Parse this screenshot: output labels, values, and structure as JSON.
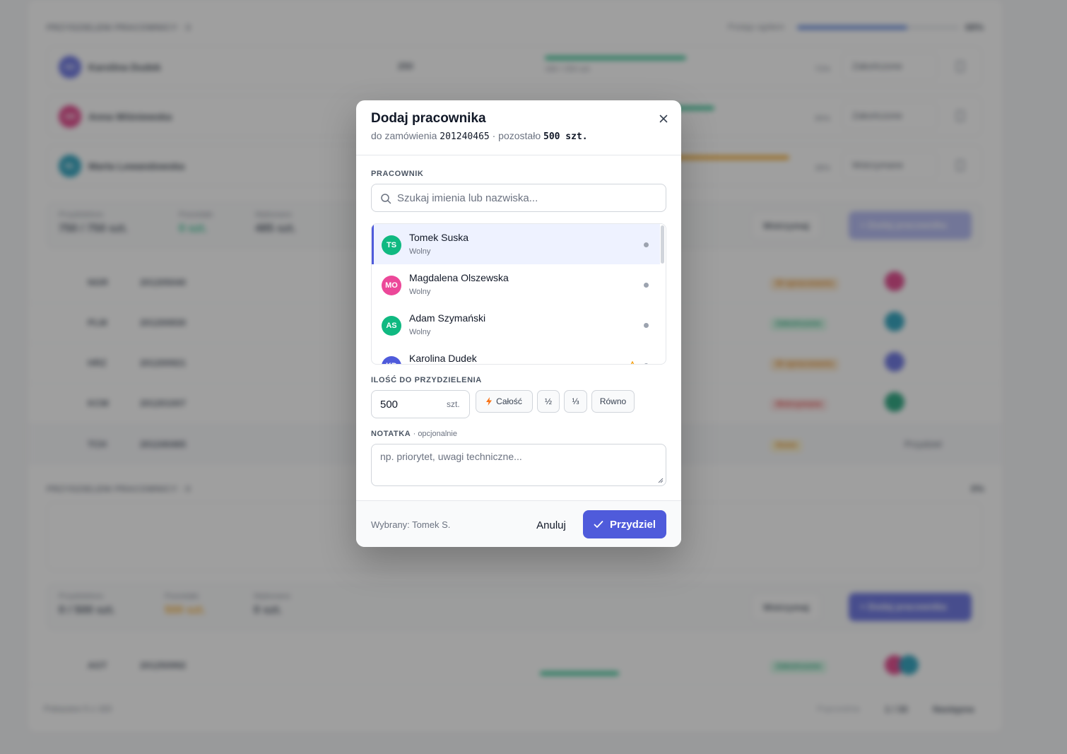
{
  "background": {
    "section1_label": "PRZYDZIELENI PRACOWNICY · 3",
    "overall_progress_label": "Postęp ogółem",
    "overall_progress_value": "68%",
    "overall_progress_fraction": 0.68,
    "workers": [
      {
        "initials": "KD",
        "name": "Karolina Dudek",
        "qty": "250",
        "unit": "szt.",
        "progress_text": "180 / 250 szt.",
        "pct": "72%",
        "fraction": 0.72,
        "status": "Zakończone",
        "color": "#4f5bdb",
        "bar_color": "#10b981"
      },
      {
        "initials": "AW",
        "name": "Anna Wiśniewska",
        "qty": "",
        "unit": "",
        "progress_text": "",
        "pct": "95%",
        "fraction": 0.95,
        "status": "Zakończone",
        "color": "#db2777",
        "bar_color": "#10b981"
      },
      {
        "initials": "ML",
        "name": "Marta Lewandowska",
        "qty": "",
        "unit": "",
        "progress_text": "",
        "pct": "38%",
        "fraction": 0.38,
        "status": "Wstrzymane",
        "color": "#0891b2",
        "bar_color": "#f59e0b"
      }
    ],
    "stats1": [
      {
        "label": "Przydzielono",
        "value": "750 / 750 szt."
      },
      {
        "label": "Pozostało",
        "value": "0 szt."
      },
      {
        "label": "Wykonano",
        "value": "485 szt."
      }
    ],
    "pause_label": "Wstrzymaj",
    "add_worker_label": "+ Dodaj pracownika",
    "table_rows": [
      {
        "code": "NGR",
        "order": "201205040",
        "status": "W opracowaniu",
        "status_color": "#f59e0b"
      },
      {
        "code": "PLM",
        "order": "201200830",
        "status": "Zakończone",
        "status_color": "#10b981"
      },
      {
        "code": "HRZ",
        "order": "201200921",
        "status": "W opracowaniu",
        "status_color": "#f59e0b"
      },
      {
        "code": "KCM",
        "order": "201201007",
        "status": "Wstrzymane",
        "status_color": "#ef4444"
      },
      {
        "code": "TCH",
        "order": "201240465",
        "status": "Nowe",
        "status_color": "#f59e0b"
      }
    ],
    "assign_label": "Przydziel",
    "section2_label": "PRZYDZIELENI PRACOWNICY · 0",
    "overall2_value": "0%",
    "stats2": [
      {
        "label": "Przydzielono",
        "value": "0 / 500 szt."
      },
      {
        "label": "Pozostało",
        "value": "500 szt."
      },
      {
        "label": "Wykonano",
        "value": "0 szt."
      }
    ],
    "last_row": {
      "code": "AGT",
      "order": "201250992",
      "status": "Zakończone"
    },
    "footer_left": "Pokazano 5 z 163",
    "footer_pages_label": "Poprzednia",
    "footer_pages": "1 / 33",
    "footer_next": "Następna"
  },
  "modal": {
    "title": "Dodaj pracownika",
    "subtitle_prefix": "do zamówienia",
    "order_number": "201240465",
    "subtitle_remaining": "· pozostało",
    "remaining_qty": "500 szt.",
    "worker_section_label": "PRACOWNIK",
    "search_placeholder": "Szukaj imienia lub nazwiska...",
    "workers": [
      {
        "initials": "TS",
        "name": "Tomek Suska",
        "status": "Wolny",
        "color": "#10b981",
        "selected": true
      },
      {
        "initials": "MO",
        "name": "Magdalena Olszewska",
        "status": "Wolny",
        "color": "#ec4899",
        "selected": false
      },
      {
        "initials": "AS",
        "name": "Adam Szymański",
        "status": "Wolny",
        "color": "#10b981",
        "selected": false
      },
      {
        "initials": "KD",
        "name": "Karolina Dudek",
        "status": "",
        "color": "#4f5bdb",
        "selected": false
      }
    ],
    "quantity_section_label": "ILOŚĆ DO PRZYDZIELENIA",
    "quantity_value": "500",
    "quantity_unit": "szt.",
    "quick_buttons": {
      "all": "Całość",
      "half": "½",
      "third": "⅓",
      "equal": "Równo"
    },
    "note_section_label": "NOTATKA",
    "note_optional": "· opcjonalnie",
    "note_placeholder": "np. priorytet, uwagi techniczne...",
    "selected_text": "Wybrany: Tomek S.",
    "cancel_label": "Anuluj",
    "assign_label": "Przydziel",
    "accent_color": "#4f5bdb"
  }
}
